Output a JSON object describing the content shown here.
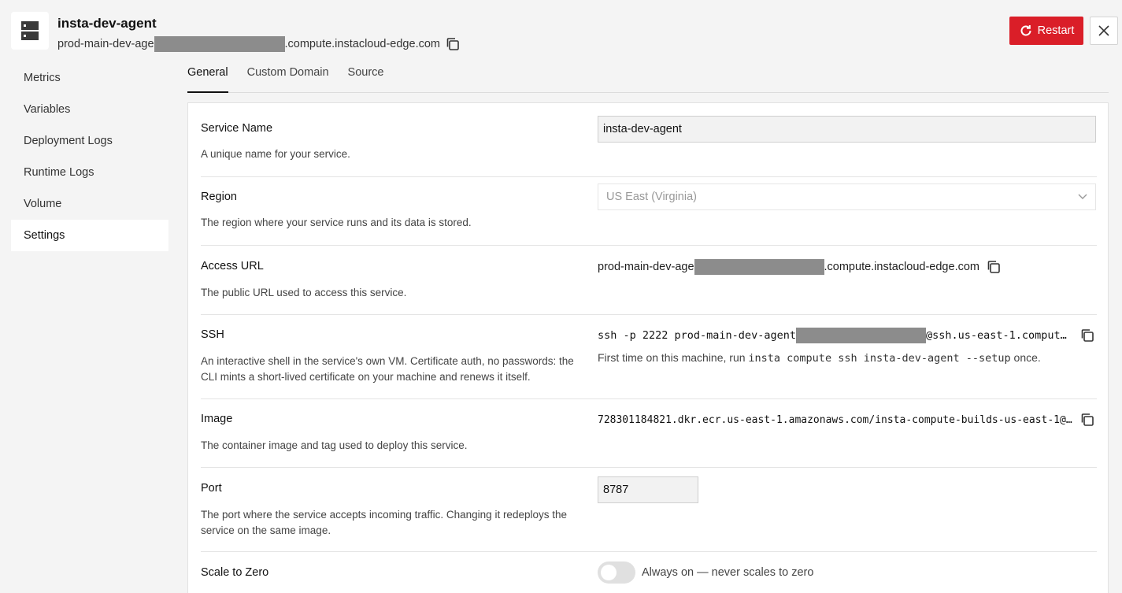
{
  "header": {
    "title": "insta-dev-agent",
    "url_prefix": "prod-main-dev-age",
    "url_suffix": ".compute.instacloud-edge.com",
    "restart_label": "Restart",
    "accent_color": "#da1e28"
  },
  "sidebar": {
    "items": [
      {
        "label": "Metrics"
      },
      {
        "label": "Variables"
      },
      {
        "label": "Deployment Logs"
      },
      {
        "label": "Runtime Logs"
      },
      {
        "label": "Volume"
      },
      {
        "label": "Settings"
      }
    ],
    "active": "Settings"
  },
  "tabs": [
    {
      "label": "General"
    },
    {
      "label": "Custom Domain"
    },
    {
      "label": "Source"
    }
  ],
  "settings": {
    "service_name": {
      "label": "Service Name",
      "desc": "A unique name for your service.",
      "value": "insta-dev-agent"
    },
    "region": {
      "label": "Region",
      "desc": "The region where your service runs and its data is stored.",
      "value": "US East (Virginia)"
    },
    "access_url": {
      "label": "Access URL",
      "desc": "The public URL used to access this service.",
      "prefix": "prod-main-dev-age",
      "suffix": ".compute.instacloud-edge.com"
    },
    "ssh": {
      "label": "SSH",
      "desc": "An interactive shell in the service's own VM. Certificate auth, no passwords: the CLI mints a short-lived certificate on your machine and renews it itself.",
      "cmd_prefix": "ssh -p 2222 prod-main-dev-agent",
      "cmd_suffix": "@ssh.us-east-1.comput…",
      "hint_before": "First time on this machine, run ",
      "hint_code": "insta compute ssh insta-dev-agent --setup",
      "hint_after": " once."
    },
    "image": {
      "label": "Image",
      "desc": "The container image and tag used to deploy this service.",
      "value": "728301184821.dkr.ecr.us-east-1.amazonaws.com/insta-compute-builds-us-east-1@…"
    },
    "port": {
      "label": "Port",
      "desc": "The port where the service accepts incoming traffic. Changing it redeploys the service on the same image.",
      "value": "8787"
    },
    "scale_to_zero": {
      "label": "Scale to Zero",
      "toggle_text": "Always on — never scales to zero",
      "enabled": false
    }
  }
}
